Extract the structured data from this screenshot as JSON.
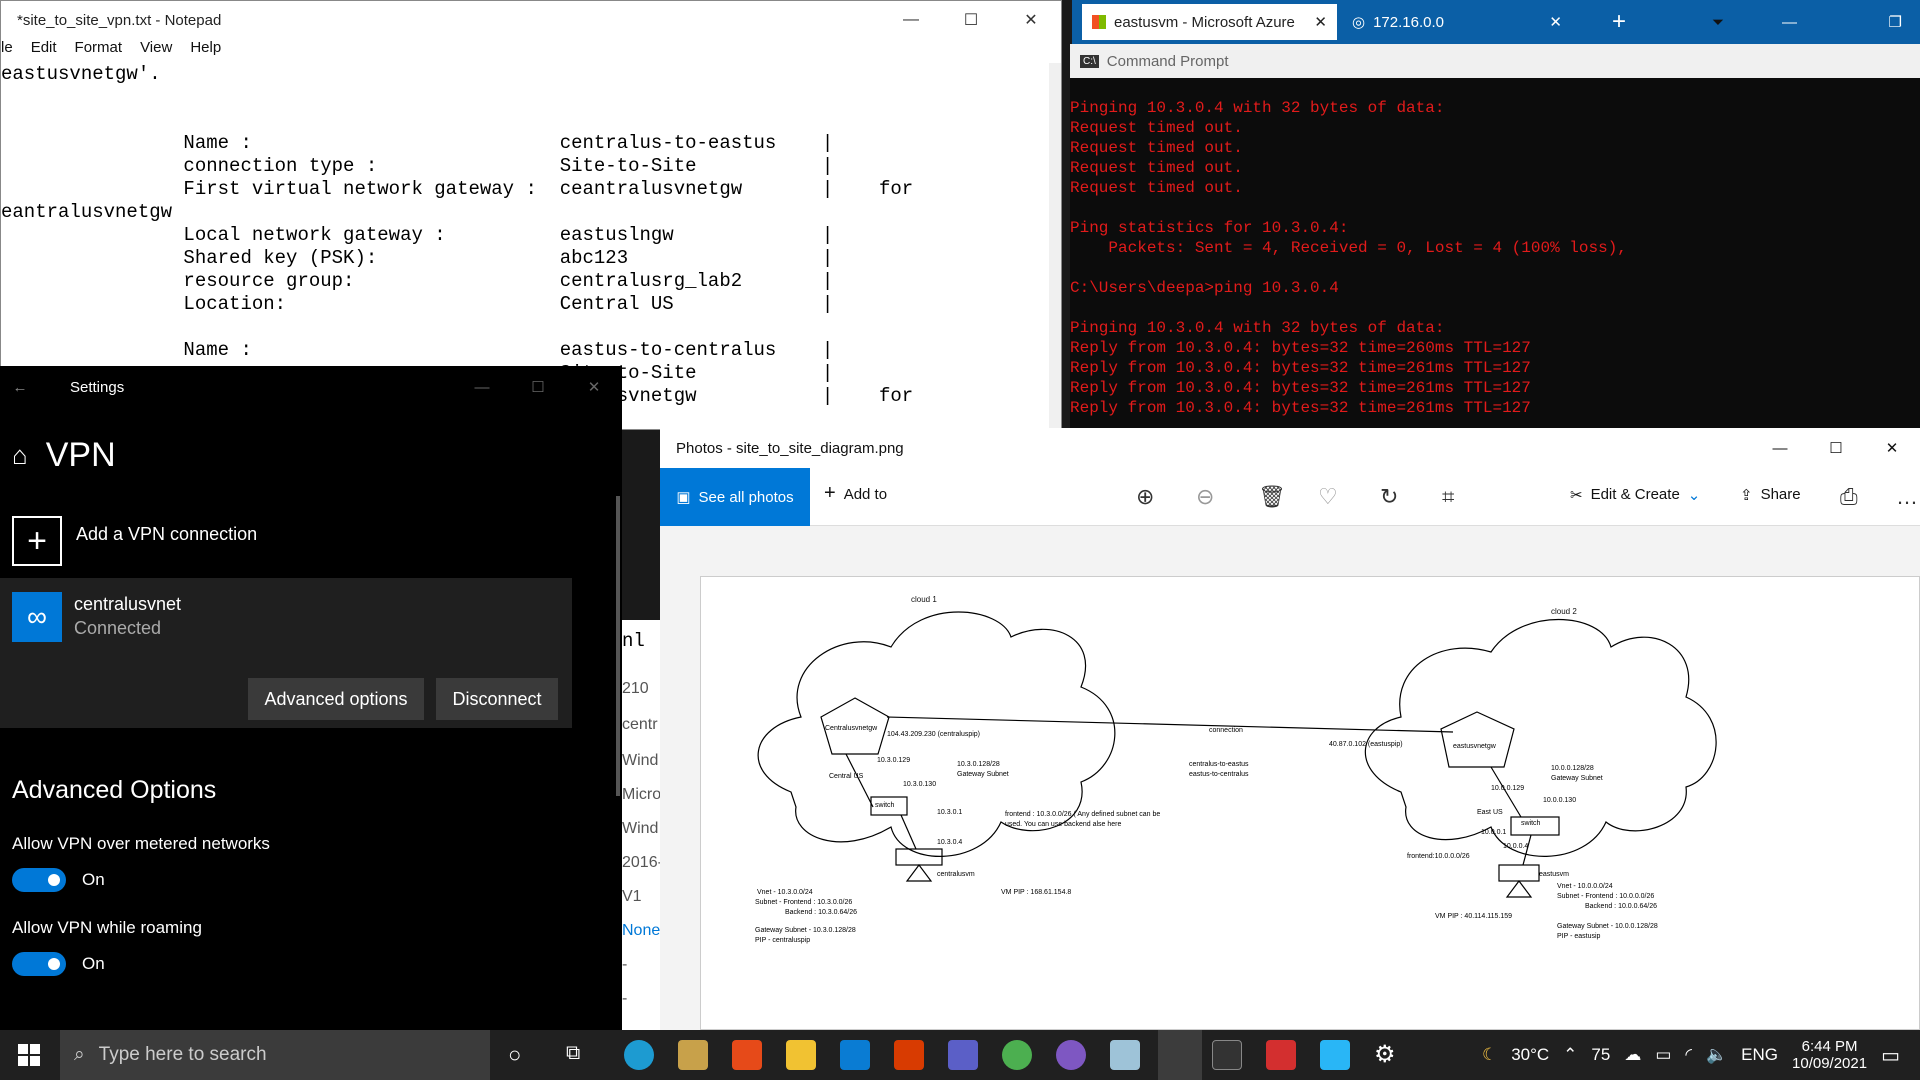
{
  "notepad": {
    "title": "*site_to_site_vpn.txt - Notepad",
    "menu": [
      "le",
      "Edit",
      "Format",
      "View",
      "Help"
    ],
    "lines": [
      "eastusvnetgw'.",
      "",
      "",
      "                Name :                           centralus-to-eastus    |",
      "                connection type :                Site-to-Site           |",
      "                First virtual network gateway :  ceantralusvnetgw       |    for",
      "eantralusvnetgw",
      "                Local network gateway :          eastuslngw             |",
      "                Shared key (PSK):                abc123                 |",
      "                resource group:                  centralusrg_lab2       |",
      "                Location:                        Central US             |",
      "",
      "                Name :                           eastus-to-centralus    |",
      "                                                 Site-to-Site           |",
      "                                                 eastusvnetgw           |    for"
    ]
  },
  "chrome": {
    "tab1": "eastusvm - Microsoft Azure",
    "tab2": "172.16.0.0"
  },
  "cmd": {
    "title": "Command Prompt",
    "lines": [
      "Pinging 10.3.0.4 with 32 bytes of data:",
      "Request timed out.",
      "Request timed out.",
      "Request timed out.",
      "Request timed out.",
      "",
      "Ping statistics for 10.3.0.4:",
      "    Packets: Sent = 4, Received = 0, Lost = 4 (100% loss),",
      "",
      "C:\\Users\\deepa>ping 10.3.0.4",
      "",
      "Pinging 10.3.0.4 with 32 bytes of data:",
      "Reply from 10.3.0.4: bytes=32 time=260ms TTL=127",
      "Reply from 10.3.0.4: bytes=32 time=261ms TTL=127",
      "Reply from 10.3.0.4: bytes=32 time=261ms TTL=127",
      "Reply from 10.3.0.4: bytes=32 time=261ms TTL=127"
    ]
  },
  "settings": {
    "title": "Settings",
    "heading": "VPN",
    "add": "Add a VPN connection",
    "conn_name": "centralusvnet",
    "conn_status": "Connected",
    "adv_btn": "Advanced options",
    "disc_btn": "Disconnect",
    "adv_heading": "Advanced Options",
    "opt1": "Allow VPN over metered networks",
    "opt1_val": "On",
    "opt2": "Allow VPN while roaming",
    "opt2_val": "On"
  },
  "strip": [
    "nl",
    "210",
    "centr",
    "Wind",
    "Micro",
    "Wind",
    "2016-",
    "V1",
    "None",
    "-",
    "-"
  ],
  "photos": {
    "title": "Photos - site_to_site_diagram.png",
    "see_all": "See all photos",
    "add_to": "Add to",
    "edit": "Edit & Create",
    "share": "Share"
  },
  "diagram": {
    "cloud1": "cloud 1",
    "cloud2": "cloud 2",
    "gw1": "Centralusvnetgw",
    "gw2": "eastusvnetgw",
    "region1": "Central US",
    "region2": "East US",
    "pip1": "104.43.209.230 (centraluspip)",
    "pip2": "40.87.0.102 (eastuspip)",
    "connection": "connection",
    "conn_names": "centralus-to-eastus",
    "conn_names2": "eastus-to-centralus",
    "ip1": "10.3.0.129",
    "gwsub1": "10.3.0.128/28",
    "gwsub1b": "Gateway Subnet",
    "ip1b": "10.3.0.130",
    "switch": "switch",
    "ip1c": "10.3.0.1",
    "ip1d": "10.3.0.4",
    "frontend1": "frontend : 10.3.0.0/26 ( Any defined subnet can be",
    "frontend1b": "used. You can use backend alse here",
    "vm1": "centralusvm",
    "vmpip1": "VM PIP : 168.61.154.8",
    "vnet1": "Vnet -  10.3.0.0/24",
    "subfront1": "Subnet - Frontend : 10.3.0.0/26",
    "back1": "Backend   : 10.3.0.64/26",
    "gws1": "Gateway Subnet -  10.3.0.128/28",
    "pipn1": "PIP - centraluspip",
    "ip2": "10.0.0.129",
    "gwsub2": "10.0.0.128/28",
    "gwsub2b": "Gateway Subnet",
    "ip2b": "10.0.0.130",
    "ip2c": "10.0.0.1",
    "ip2d": "10.0.0.4",
    "frontend2": "frontend:10.0.0.0/26",
    "vm2": "eastusvm",
    "vmpip2": "VM  PIP : 40.114.115.159",
    "vnet2": "Vnet - 10.0.0.0/24",
    "subfront2": "Subnet - Frontend : 10.0.0.0/26",
    "back2": "Backend :  10.0.0.64/26",
    "gws2": "Gateway Subnet -  10.0.0.128/28",
    "pipn2": "PIP -  eastusip"
  },
  "taskbar": {
    "search": "Type here to search",
    "temp": "30°C",
    "num": "75",
    "lang": "ENG",
    "time": "6:44 PM",
    "date": "10/09/2021"
  }
}
